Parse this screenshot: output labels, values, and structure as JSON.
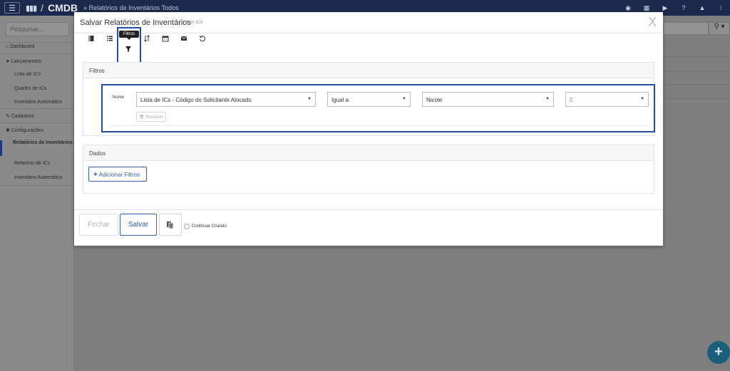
{
  "topbar": {
    "app_name": "CMDB",
    "separator": "/",
    "breadcrumb": "» Relatórios de Inventários Todos"
  },
  "sidebar": {
    "search_placeholder": "Pesquisar...",
    "items": [
      {
        "label": "Dashboard",
        "icon": "home-icon"
      },
      {
        "label": "Lançamentos",
        "icon": "send-icon"
      },
      {
        "label": "Lista de ICs"
      },
      {
        "label": "Quadro de ICs"
      },
      {
        "label": "Inventário Automático"
      },
      {
        "label": "Cadastros",
        "icon": "edit-icon"
      },
      {
        "label": "Configurações",
        "icon": "gear-icon"
      },
      {
        "label": "Relatórios de Inventários"
      },
      {
        "label": "Relatório de ICs"
      },
      {
        "label": "Inventário Automático"
      }
    ]
  },
  "modal": {
    "title": "Salvar Relatórios de Inventários",
    "subtitle": "Com ICS",
    "close": "X",
    "toolbar": [
      {
        "name": "book-icon"
      },
      {
        "name": "list-icon"
      },
      {
        "name": "filter-icon"
      },
      {
        "name": "sort-icon"
      },
      {
        "name": "calendar-icon"
      },
      {
        "name": "envelope-icon"
      },
      {
        "name": "history-icon"
      }
    ],
    "tooltip": "Filtros",
    "filters_panel": {
      "heading": "Filtros",
      "row": {
        "label": "Nome",
        "field": "Lista de ICs - Código do Solicitante Alocado",
        "operator": "Igual a",
        "value": "Nicole",
        "connector": "E",
        "remove_label": "Remover"
      }
    },
    "data_panel": {
      "heading": "Dados",
      "add_button": "Adicionar Filtros",
      "add_symbol": "+"
    },
    "footer": {
      "close_label": "Fechar",
      "save_label": "Salvar",
      "continue_label": "Continuar Criando"
    }
  },
  "colors": {
    "topbar": "#1d2a4d",
    "highlight": "#1f4fa8",
    "accent": "#2a5ea8",
    "fab": "#1b5f7c"
  }
}
